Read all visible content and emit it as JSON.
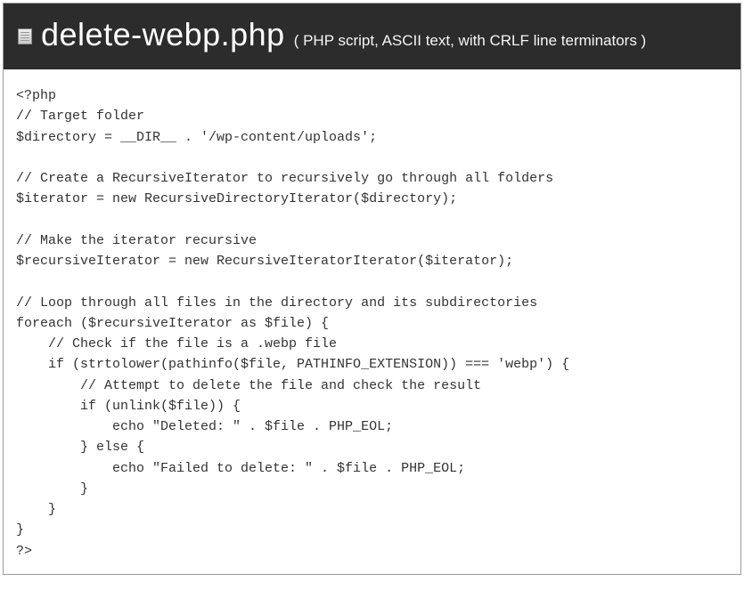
{
  "header": {
    "filename": "delete-webp.php",
    "description": "( PHP script, ASCII text, with CRLF line terminators )"
  },
  "code": {
    "lines": [
      "<?php",
      "// Target folder",
      "$directory = __DIR__ . '/wp-content/uploads';",
      "",
      "// Create a RecursiveIterator to recursively go through all folders",
      "$iterator = new RecursiveDirectoryIterator($directory);",
      "",
      "// Make the iterator recursive",
      "$recursiveIterator = new RecursiveIteratorIterator($iterator);",
      "",
      "// Loop through all files in the directory and its subdirectories",
      "foreach ($recursiveIterator as $file) {",
      "    // Check if the file is a .webp file",
      "    if (strtolower(pathinfo($file, PATHINFO_EXTENSION)) === 'webp') {",
      "        // Attempt to delete the file and check the result",
      "        if (unlink($file)) {",
      "            echo \"Deleted: \" . $file . PHP_EOL;",
      "        } else {",
      "            echo \"Failed to delete: \" . $file . PHP_EOL;",
      "        }",
      "    }",
      "}",
      "?>"
    ]
  }
}
